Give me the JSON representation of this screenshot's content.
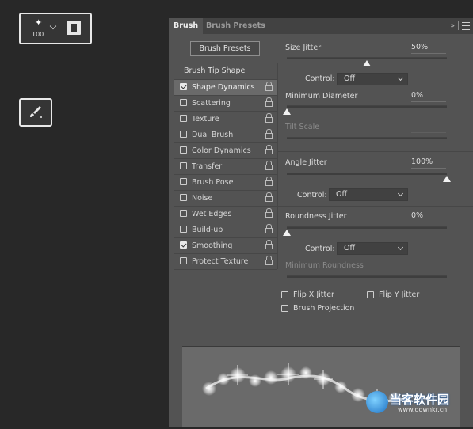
{
  "options_bar": {
    "brush_size": "100",
    "brush_picker_icon": "brush-tip-dot-icon",
    "toggle_brush_panel_icon": "brush-panel-toggle-icon"
  },
  "tool": {
    "icon": "paintbrush-icon"
  },
  "panel": {
    "tabs": [
      "Brush",
      "Brush Presets"
    ],
    "presets_button": "Brush Presets",
    "list_header": "Brush Tip Shape",
    "items": [
      {
        "label": "Shape Dynamics",
        "checked": true,
        "active": true
      },
      {
        "label": "Scattering",
        "checked": false
      },
      {
        "label": "Texture",
        "checked": false
      },
      {
        "label": "Dual Brush",
        "checked": false
      },
      {
        "label": "Color Dynamics",
        "checked": false
      },
      {
        "label": "Transfer",
        "checked": false
      },
      {
        "label": "Brush Pose",
        "checked": false
      },
      {
        "label": "Noise",
        "checked": false
      },
      {
        "label": "Wet Edges",
        "checked": false
      },
      {
        "label": "Build-up",
        "checked": false
      },
      {
        "label": "Smoothing",
        "checked": true
      },
      {
        "label": "Protect Texture",
        "checked": false
      }
    ],
    "settings": {
      "size_jitter": {
        "label": "Size Jitter",
        "value": "50%",
        "level": 0.5
      },
      "control1": {
        "label": "Control:",
        "value": "Off"
      },
      "min_diameter": {
        "label": "Minimum Diameter",
        "value": "0%",
        "level": 0
      },
      "tilt_scale": {
        "label": "Tilt Scale"
      },
      "angle_jitter": {
        "label": "Angle Jitter",
        "value": "100%",
        "level": 1.0
      },
      "control2": {
        "label": "Control:",
        "value": "Off"
      },
      "roundness_jitter": {
        "label": "Roundness Jitter",
        "value": "0%",
        "level": 0
      },
      "control3": {
        "label": "Control:",
        "value": "Off"
      },
      "min_roundness": {
        "label": "Minimum Roundness"
      }
    },
    "options": {
      "flip_x": {
        "label": "Flip X Jitter",
        "checked": false
      },
      "flip_y": {
        "label": "Flip Y Jitter",
        "checked": false
      },
      "brush_projection": {
        "label": "Brush Projection",
        "checked": false
      }
    }
  },
  "watermark": {
    "text": "当客软件园",
    "url": "www.downkr.cn"
  }
}
